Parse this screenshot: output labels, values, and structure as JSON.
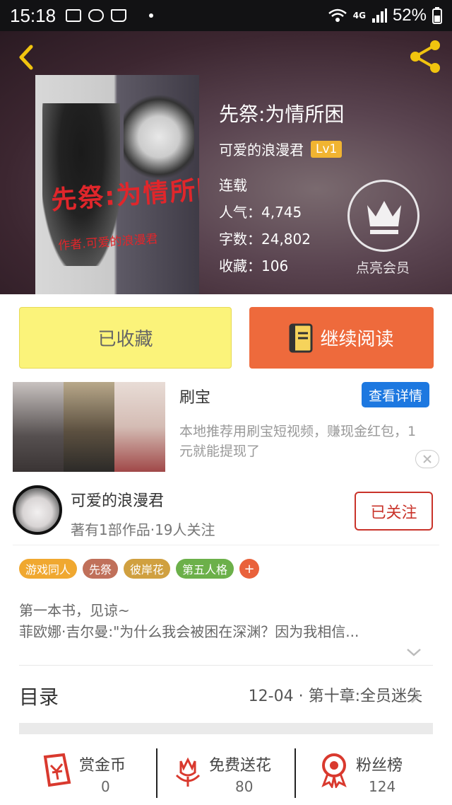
{
  "status_bar": {
    "time": "15:18",
    "network": "4G",
    "battery": "52%"
  },
  "book": {
    "title": "先祭:为情所困",
    "author": "可爱的浪漫君",
    "level": "Lv1",
    "status": "连载",
    "popularity": "人气：4,745",
    "word_count": "字数：24,802",
    "favorites": "收藏：106",
    "cover_title": "先祭:为情所困",
    "cover_author": "作者.可爱的浪漫君"
  },
  "vip": {
    "label": "点亮会员"
  },
  "actions": {
    "collected": "已收藏",
    "continue_read": "继续阅读"
  },
  "ad": {
    "title": "刷宝",
    "button": "查看详情",
    "desc": "本地推荐用刷宝短视频，赚现金红包，1元就能提现了"
  },
  "author_card": {
    "name": "可爱的浪漫君",
    "sub": "著有1部作品·19人关注",
    "follow": "已关注"
  },
  "tags": [
    {
      "label": "游戏同人",
      "color": "#f0a830"
    },
    {
      "label": "先祭",
      "color": "#c0705a"
    },
    {
      "label": "彼岸花",
      "color": "#d0a040"
    },
    {
      "label": "第五人格",
      "color": "#6cb04a"
    }
  ],
  "tag_add": "+",
  "description": {
    "line1": "第一本书，见谅~",
    "line2": "菲欧娜·吉尔曼:\"为什么我会被困在深渊？因为我相信..."
  },
  "toc": {
    "label": "目录",
    "latest": "12-04 · 第十章:全员迷失"
  },
  "stats": [
    {
      "label": "赏金币",
      "value": "0",
      "icon": "gold-coin-icon"
    },
    {
      "label": "免费送花",
      "value": "80",
      "icon": "flower-icon"
    },
    {
      "label": "粉丝榜",
      "value": "124",
      "icon": "medal-icon"
    }
  ],
  "colors": {
    "accent_orange": "#ee6a3c",
    "collected_yellow": "#fbf37a",
    "follow_red": "#c9332a",
    "icon_red": "#d9392e"
  }
}
